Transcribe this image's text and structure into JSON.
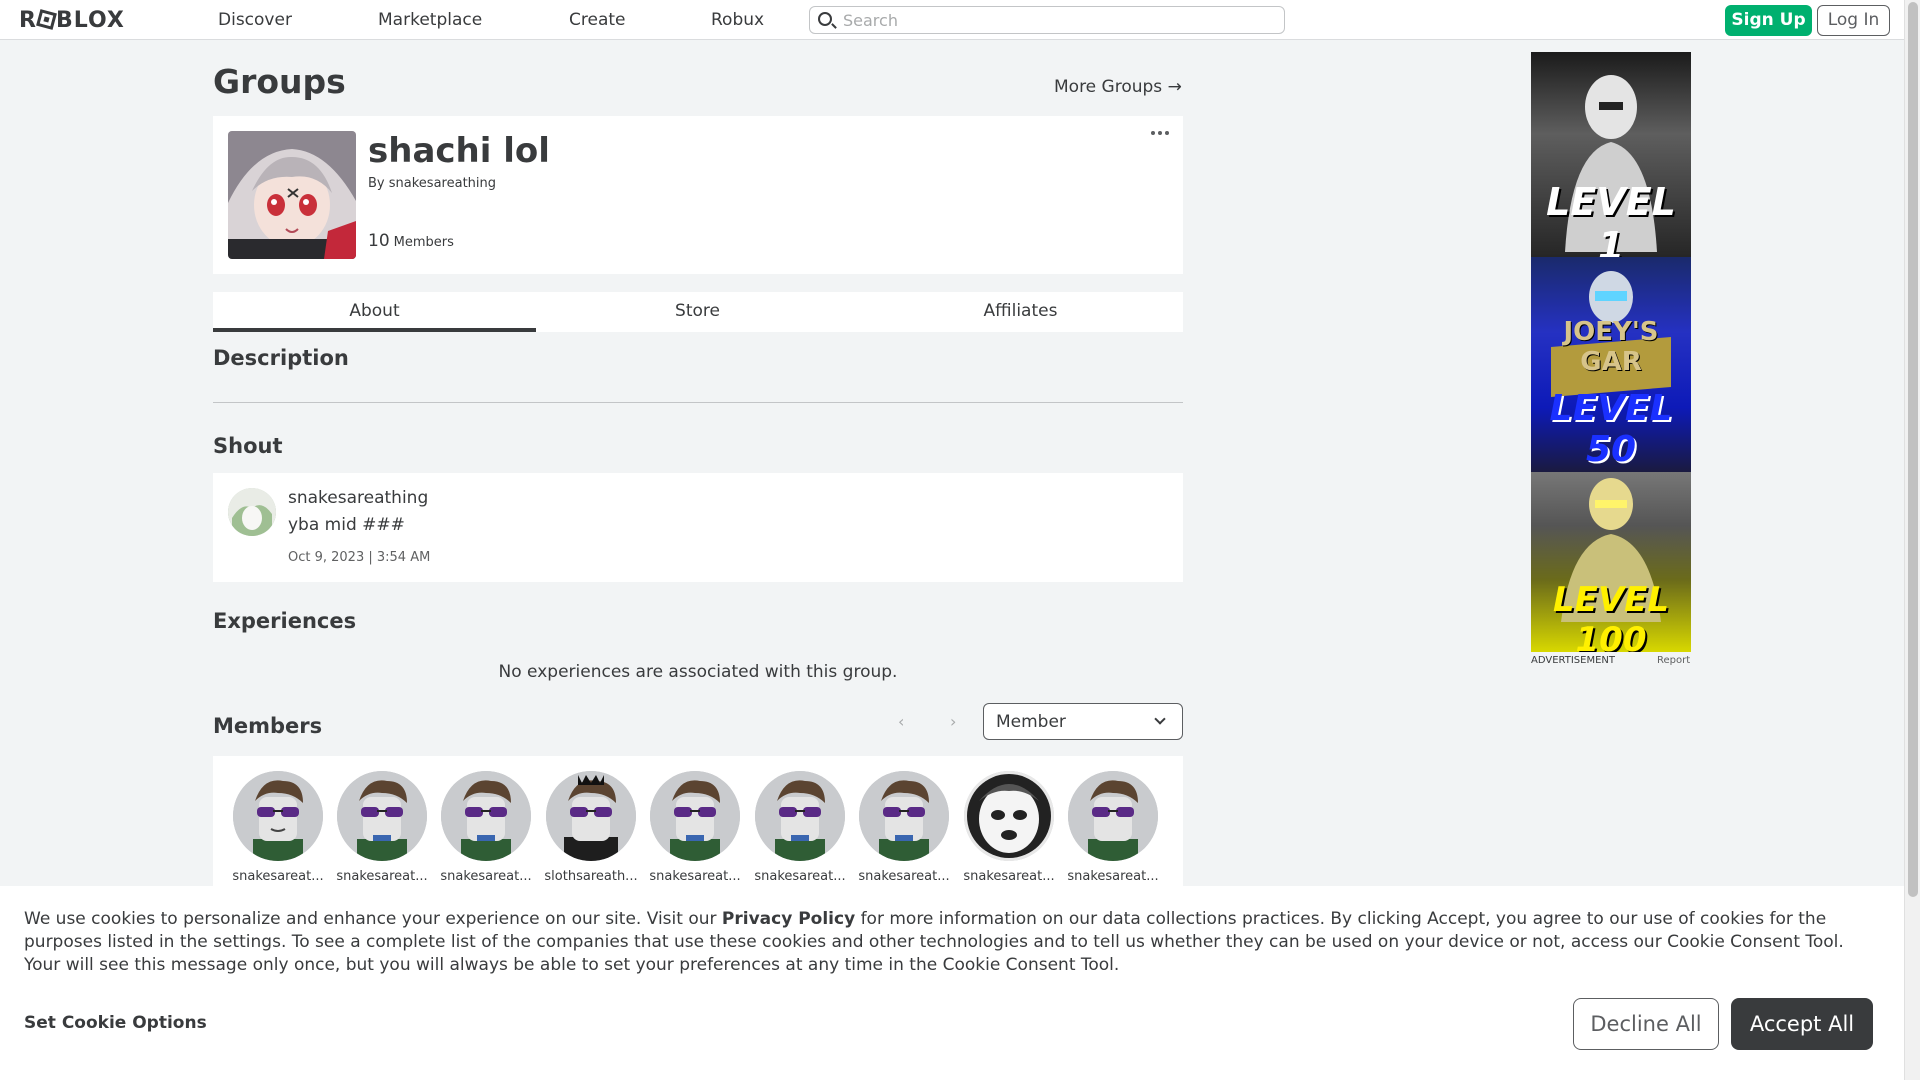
{
  "nav": {
    "logo": "ROBLOX",
    "links": [
      "Discover",
      "Marketplace",
      "Create",
      "Robux"
    ],
    "search_placeholder": "Search",
    "signup_label": "Sign Up",
    "login_label": "Log In"
  },
  "page": {
    "title": "Groups",
    "more_groups": "More Groups →"
  },
  "group": {
    "name": "shachi lol",
    "by_prefix": "By",
    "owner": "snakesareathing",
    "member_count": "10",
    "members_label": "Members"
  },
  "tabs": [
    "About",
    "Store",
    "Affiliates"
  ],
  "sections": {
    "description": "Description",
    "shout": "Shout",
    "experiences": "Experiences",
    "members": "Members"
  },
  "shout": {
    "user": "snakesareathing",
    "body": "yba mid ###",
    "date": "Oct 9, 2023 | 3:54 AM"
  },
  "experiences_empty": "No experiences are associated with this group.",
  "members_filter": {
    "prev": "‹",
    "next": "›",
    "selected": "Member"
  },
  "members": [
    {
      "name": "snakesareat..."
    },
    {
      "name": "snakesareat..."
    },
    {
      "name": "snakesareat..."
    },
    {
      "name": "slothsareath..."
    },
    {
      "name": "snakesareat..."
    },
    {
      "name": "snakesareat..."
    },
    {
      "name": "snakesareat..."
    },
    {
      "name": "snakesareat..."
    },
    {
      "name": "snakesareat..."
    }
  ],
  "ad": {
    "texts": [
      "LEVEL 1",
      "JOEY'S GAR",
      "LEVEL 50",
      "LEVEL 100"
    ],
    "label": "ADVERTISEMENT",
    "report": "Report"
  },
  "cookie": {
    "text_before": "We use cookies to personalize and enhance your experience on our site. Visit our ",
    "privacy_link": "Privacy Policy",
    "text_after": " for more information on our data collections practices. By clicking Accept, you agree to our use of cookies for the purposes listed in the settings. To see a complete list of the companies that use these cookies and other technologies and to tell us whether they can be used on your device or not, access our Cookie Consent Tool. Your will see this message only once, but you will always be able to set your preferences at any time in the Cookie Consent Tool.",
    "set_options": "Set Cookie Options",
    "decline": "Decline All",
    "accept": "Accept All"
  },
  "colors": {
    "signup": "#00b06f",
    "accept": "#393b3d",
    "background": "#f2f4f5"
  }
}
